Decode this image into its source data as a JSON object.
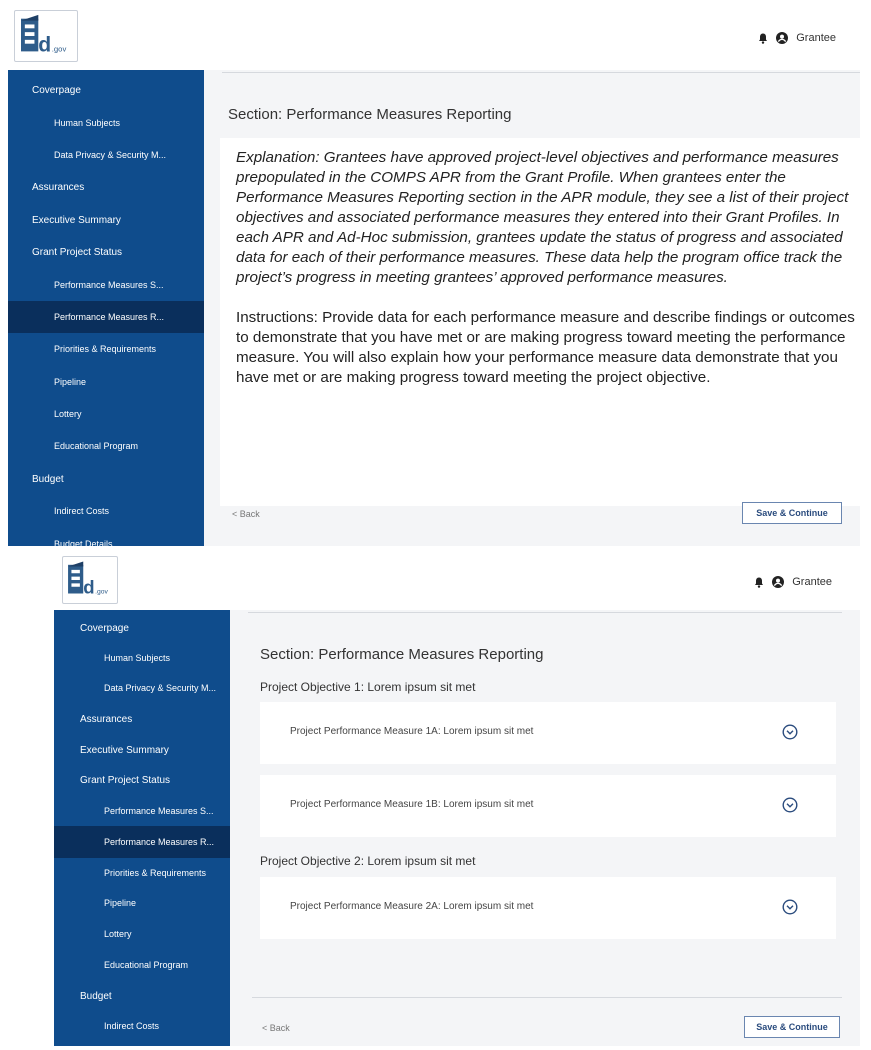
{
  "app": {
    "logo_text": ".gov",
    "user_name": "Grantee"
  },
  "nav": [
    {
      "label": "Coverpage",
      "level": "top"
    },
    {
      "label": "Human Subjects",
      "level": "sub"
    },
    {
      "label": "Data Privacy & Security M...",
      "level": "sub"
    },
    {
      "label": "Assurances",
      "level": "top"
    },
    {
      "label": "Executive Summary",
      "level": "top"
    },
    {
      "label": "Grant Project Status",
      "level": "top"
    },
    {
      "label": "Performance Measures S...",
      "level": "sub"
    },
    {
      "label": "Performance Measures R...",
      "level": "sub",
      "active": true
    },
    {
      "label": "Priorities & Requirements",
      "level": "sub"
    },
    {
      "label": "Pipeline",
      "level": "sub"
    },
    {
      "label": "Lottery",
      "level": "sub"
    },
    {
      "label": "Educational Program",
      "level": "sub"
    },
    {
      "label": "Budget",
      "level": "top"
    },
    {
      "label": "Indirect Costs",
      "level": "sub"
    },
    {
      "label": "Budget Details",
      "level": "sub"
    }
  ],
  "section_title": "Section: Performance Measures Reporting",
  "explanation": "Explanation: Grantees have approved project-level objectives and performance measures prepopulated in the COMPS APR from the Grant Profile. When grantees enter the Performance Measures Reporting section in the APR module, they see a list of their project objectives and associated performance measures they entered into their Grant Profiles. In each APR and Ad-Hoc submission, grantees update the status of progress and associated data for each of their performance measures. These data help the program office track the project’s progress in meeting grantees’ approved performance measures.",
  "instructions": "Instructions: Provide data for each performance measure and describe findings or outcomes to demonstrate that you have met or are making progress toward meeting the performance measure. You will also explain how your performance measure data demonstrate that you have met or are making progress toward meeting the project objective.",
  "objectives": [
    {
      "title": "Project Objective 1: Lorem ipsum sit met",
      "measures": [
        "Project Performance Measure 1A: Lorem ipsum sit met",
        "Project Performance Measure 1B: Lorem ipsum sit met"
      ]
    },
    {
      "title": "Project Objective 2: Lorem ipsum sit met",
      "measures": [
        "Project Performance Measure 2A: Lorem ipsum sit met"
      ]
    }
  ],
  "footer": {
    "back_label": "< Back",
    "save_label": "Save & Continue"
  },
  "colors": {
    "sidebar": "#0f4c8c",
    "sidebar_active": "#0a2f5c",
    "button_border": "#6a86b0"
  }
}
